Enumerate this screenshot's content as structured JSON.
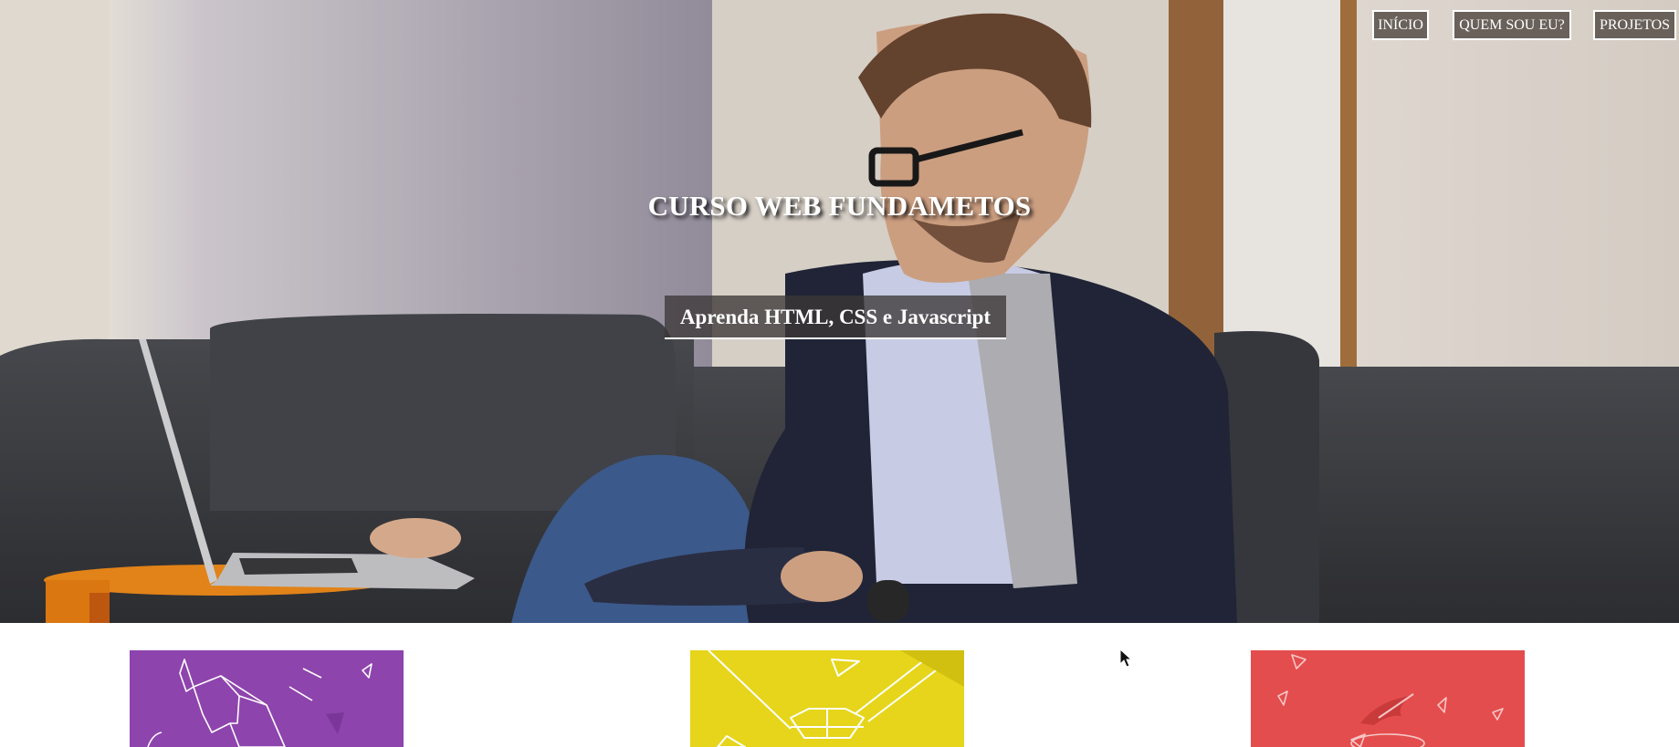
{
  "nav": {
    "items": [
      {
        "label": "INÍCIO"
      },
      {
        "label": "QUEM SOU EU?"
      },
      {
        "label": "PROJETOS"
      }
    ]
  },
  "hero": {
    "title": "CURSO WEB FUNDAMETOS",
    "subtitle": "Aprenda HTML, CSS e Javascript"
  },
  "cards": [
    {
      "icon": "origami-elephant-icon",
      "color": "#8e44ad"
    },
    {
      "icon": "diamond-pencil-icon",
      "color": "#e6d51a"
    },
    {
      "icon": "paper-bird-icon",
      "color": "#e44d4d"
    }
  ]
}
